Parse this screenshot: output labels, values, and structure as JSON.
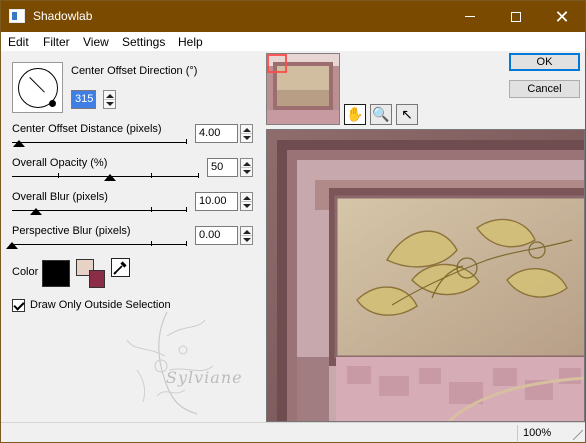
{
  "window": {
    "title": "Shadowlab",
    "minimize_icon": "minimize-icon",
    "maximize_icon": "maximize-icon",
    "close_glyph": "✕",
    "accent": "#7a4a00"
  },
  "menu": [
    "Edit",
    "Filter",
    "View",
    "Settings",
    "Help"
  ],
  "controls": {
    "center_offset_direction": {
      "label": "Center Offset Direction (°)",
      "value": "315"
    },
    "center_offset_distance": {
      "label": "Center Offset Distance (pixels)",
      "value": "4.00",
      "slider_fraction": 0.03
    },
    "overall_opacity": {
      "label": "Overall Opacity (%)",
      "value": "50",
      "slider_fraction": 0.5
    },
    "overall_blur": {
      "label": "Overall Blur (pixels)",
      "value": "10.00",
      "slider_fraction": 0.12
    },
    "perspective_blur": {
      "label": "Perspective Blur (pixels)",
      "value": "0.00",
      "slider_fraction": 0.0
    },
    "color": {
      "label": "Color",
      "primary": "#000000",
      "secondary_light": "#e7d3c6",
      "secondary_dark": "#8b2d47"
    },
    "draw_only_outside": {
      "label": "Draw Only Outside Selection",
      "checked": true
    }
  },
  "buttons": {
    "ok": "OK",
    "cancel": "Cancel"
  },
  "tools": [
    "hand-icon",
    "zoom-icon",
    "pointer-icon"
  ],
  "watermark": {
    "text": "Sylviane"
  },
  "status": {
    "zoom": "100%"
  }
}
